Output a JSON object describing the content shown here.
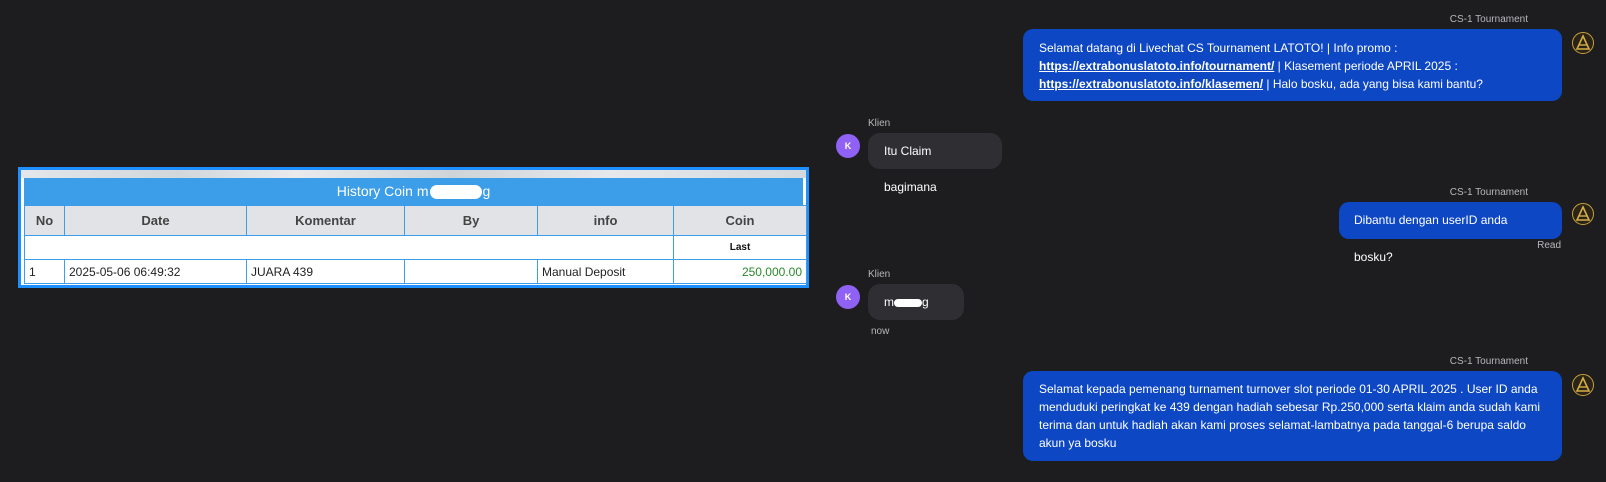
{
  "history": {
    "title_prefix": "History Coin m",
    "title_suffix": "g",
    "headers": [
      "No",
      "Date",
      "Komentar",
      "By",
      "info",
      "Coin"
    ],
    "last_label": "Last",
    "rows": [
      {
        "no": "1",
        "date": "2025-05-06 06:49:32",
        "komentar": "JUARA 439",
        "by": "",
        "info": "Manual Deposit",
        "coin": "250,000.00"
      }
    ]
  },
  "chat": {
    "messages": [
      {
        "sender": "CS-1 Tournament",
        "text_a": "Selamat datang di Livechat CS Tournament LATOTO! | Info promo : ",
        "link_a": "https://extrabonuslatoto.info/tournament/",
        "text_b": " | Klasement periode APRIL 2025 : ",
        "link_b": "https://extrabonuslatoto.info/klasemen/",
        "text_c": " | Halo bosku, ada yang bisa kami bantu?"
      },
      {
        "sender": "Klien",
        "text": "Itu Claim bagimana",
        "avatar": "K"
      },
      {
        "sender": "CS-1 Tournament",
        "text": "Dibantu dengan userID anda bosku?",
        "status": "Read"
      },
      {
        "sender": "Klien",
        "text_prefix": "m",
        "text_suffix": "g",
        "avatar": "K",
        "time": "now"
      },
      {
        "sender": "CS-1 Tournament",
        "text": "Selamat kepada pemenang turnament turnover slot periode 01-30 APRIL 2025 . User ID anda menduduki peringkat ke 439 dengan hadiah sebesar Rp.250,000 serta klaim anda sudah kami terima dan untuk hadiah akan kami proses selamat-lambatnya pada tanggal-6 berupa saldo akun ya bosku"
      }
    ]
  },
  "colors": {
    "agent_bubble": "#0d47c4",
    "client_bubble": "#2e2e33",
    "client_avatar": "#8f62f5",
    "table_header": "#3c9de8",
    "coin_value": "#2a8a2a",
    "background": "#1d1d1f"
  },
  "icons": {
    "agent_avatar": "latoto-logo-icon",
    "client_avatar": "letter-avatar"
  }
}
